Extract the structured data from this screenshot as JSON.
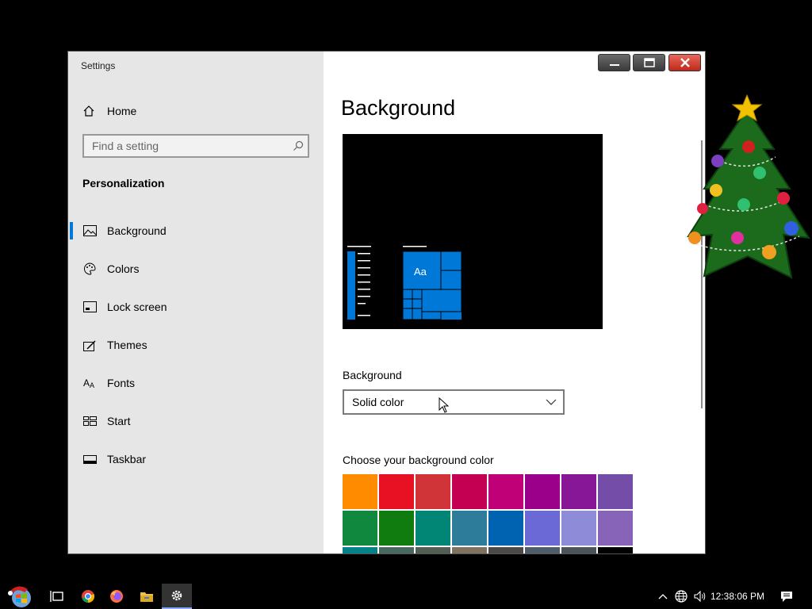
{
  "window": {
    "title": "Settings"
  },
  "sidebar": {
    "home_label": "Home",
    "search_placeholder": "Find a setting",
    "section_title": "Personalization",
    "items": [
      {
        "label": "Background",
        "icon": "picture-icon",
        "selected": true
      },
      {
        "label": "Colors",
        "icon": "palette-icon",
        "selected": false
      },
      {
        "label": "Lock screen",
        "icon": "lock-screen-icon",
        "selected": false
      },
      {
        "label": "Themes",
        "icon": "themes-icon",
        "selected": false
      },
      {
        "label": "Fonts",
        "icon": "fonts-icon",
        "selected": false
      },
      {
        "label": "Start",
        "icon": "start-icon",
        "selected": false
      },
      {
        "label": "Taskbar",
        "icon": "taskbar-icon",
        "selected": false
      }
    ]
  },
  "main": {
    "title": "Background",
    "preview_text": "Aa",
    "background_label": "Background",
    "background_value": "Solid color",
    "color_label": "Choose your background color",
    "swatches": [
      "#FF8C00",
      "#E81123",
      "#D13438",
      "#C30052",
      "#BF0077",
      "#9A0089",
      "#881798",
      "#744DA9",
      "#10893E",
      "#107C10",
      "#018574",
      "#2D7D9A",
      "#0063B1",
      "#6B69D6",
      "#8E8CD8",
      "#8764B8",
      "#038387",
      "#486860",
      "#525E54",
      "#7E735F",
      "#4C4A48",
      "#515C6B",
      "#4A5459",
      "#000000"
    ]
  },
  "taskbar": {
    "clock": "12:38:06 PM",
    "icons": [
      "start-icon",
      "task-view-icon",
      "chrome-icon",
      "firefox-icon",
      "file-explorer-icon",
      "settings-icon"
    ]
  },
  "colors": {
    "accent": "#0078d7",
    "sidebar_bg": "#e6e6e6",
    "close_red": "#c0281a"
  }
}
